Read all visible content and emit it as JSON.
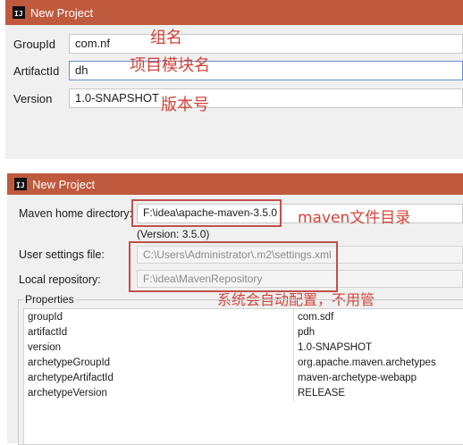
{
  "top_dialog": {
    "title": "New Project",
    "groupid_label": "GroupId",
    "groupid_value": "com.nf",
    "artifactid_label": "ArtifactId",
    "artifactid_value": "dh",
    "version_label": "Version",
    "version_value": "1.0-SNAPSHOT"
  },
  "top_annotations": {
    "group": "组名",
    "artifact": "项目模块名",
    "version": "版本号"
  },
  "bottom_dialog": {
    "title": "New Project",
    "maven_home_label": "Maven home directory:",
    "maven_home_value": "F:\\idea\\apache-maven-3.5.0",
    "maven_version": "(Version: 3.5.0)",
    "user_settings_label": "User settings file:",
    "user_settings_value": "C:\\Users\\Administrator\\.m2\\settings.xml",
    "local_repo_label": "Local repository:",
    "local_repo_value": "F:\\idea\\MavenRepository",
    "properties_legend": "Properties",
    "properties": [
      {
        "key": "groupId",
        "value": "com.sdf"
      },
      {
        "key": "artifactId",
        "value": "pdh"
      },
      {
        "key": "version",
        "value": "1.0-SNAPSHOT"
      },
      {
        "key": "archetypeGroupId",
        "value": "org.apache.maven.archetypes"
      },
      {
        "key": "archetypeArtifactId",
        "value": "maven-archetype-webapp"
      },
      {
        "key": "archetypeVersion",
        "value": "RELEASE"
      }
    ]
  },
  "bottom_annotations": {
    "maven": "maven文件目录",
    "auto": "系统会自动配置，不用管"
  },
  "colors": {
    "titlebar": "#c05a3e",
    "annotation_red": "#d0443a",
    "redbox": "#c0504d",
    "dialog_bg": "#f0f0f0"
  }
}
